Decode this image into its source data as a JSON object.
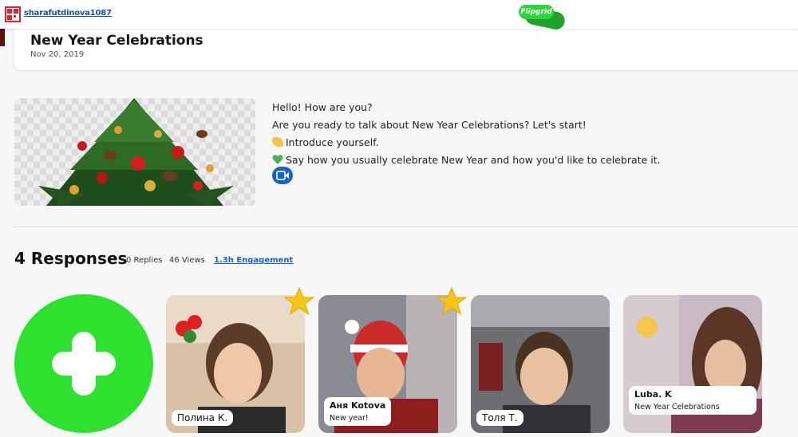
{
  "topbar": {
    "username": "sharafutdinova1087",
    "logo_text": "Flipgrid"
  },
  "topic": {
    "title": "New Year Celebrations",
    "date": "Nov 20, 2019",
    "lines": [
      "Hello! How are you?",
      "Are you ready to talk about New Year Celebrations? Let's start!",
      "Introduce yourself.",
      "Say how you usually celebrate New Year and how you'd like to celebrate it."
    ],
    "line_icons": [
      "",
      "",
      "waving-hand-icon",
      "green-heart-icon"
    ],
    "video_icon": "video-icon"
  },
  "responses": {
    "title": "4 Responses",
    "replies": "0 Replies",
    "views": "46 Views",
    "engagement": "1.3h Engagement"
  },
  "cards": [
    {
      "name": "Полина К.",
      "caption": "",
      "starred": true
    },
    {
      "name": "Аня Kotova",
      "caption": "New year!",
      "starred": true
    },
    {
      "name": "Толя Т.",
      "caption": "",
      "starred": false
    },
    {
      "name": "Luba. K",
      "caption": "New Year Celebrations",
      "starred": false
    }
  ],
  "colors": {
    "accent": "#2ee12e",
    "link": "#1a62c9",
    "star": "#f5c518"
  }
}
